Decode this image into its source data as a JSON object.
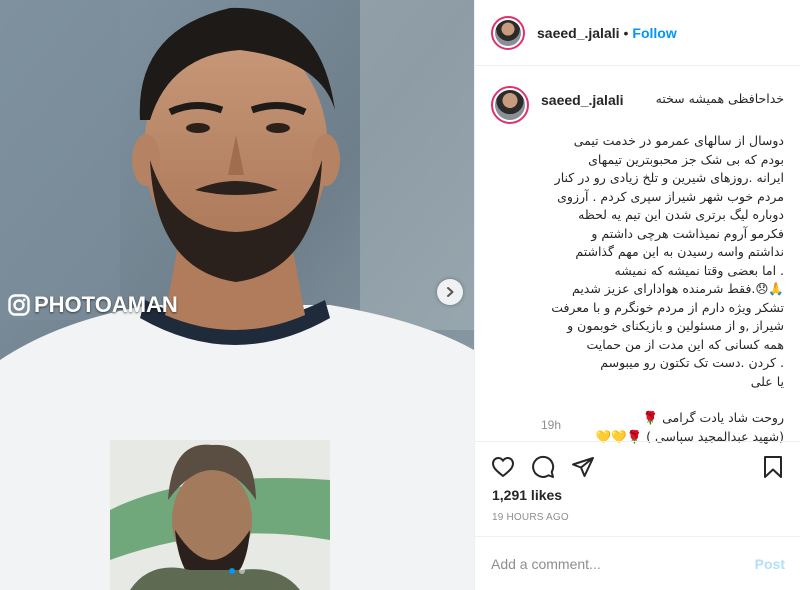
{
  "photo": {
    "watermark_text": "PHOTOAMAN",
    "slides_total": 2,
    "active_slide": 1
  },
  "header": {
    "username": "saeed_.jalali",
    "separator": "•",
    "follow_label": "Follow"
  },
  "caption": {
    "username": "saeed_.jalali",
    "first_line": "خداحافظی همیشه سخته",
    "lines": [
      "دوسال از سالهای عمرمو در خدمت تیمی",
      "بودم که بی شک جز محبوبترین تیمهای",
      "ایرانه .روزهای شیرین و تلخ زیادی رو در کنار",
      "مردم خوب شهر شیراز سپری کردم . آرزوی",
      "دوباره لیگ برتری شدن این تیم یه لحظه",
      "فکرمو آروم نمیذاشت هرچی داشتم و",
      "نداشتم واسه رسیدن به این مهم گذاشتم",
      ". اما بعضی وقتا نمیشه که نمیشه",
      "🙏😞.فقط شرمنده هوادارای عزیز شدیم",
      "تشکر ویژه دارم از مردم خونگرم و با معرفت",
      "شیراز ,و از مسئولین و بازیکنای خوبمون و",
      "همه کسانی که این مدت از من حمایت",
      ". کردن .دست تک تکتون رو میبوسم",
      "یا علی"
    ],
    "tribute_lines": [
      "روحت شاد یادت گرامی 🌹",
      "(شهید عبدالمجید سپاسی ) 🌹💛💛"
    ],
    "time_ago": "19h"
  },
  "actions": {
    "like_icon": "heart-icon",
    "comment_icon": "comment-icon",
    "share_icon": "share-icon",
    "save_icon": "bookmark-icon"
  },
  "likes": "1,291 likes",
  "post_date": "19 HOURS AGO",
  "comment_box": {
    "placeholder": "Add a comment...",
    "post_label": "Post"
  },
  "colors": {
    "accent": "#0095f6",
    "post_disabled": "#b2dffc",
    "story_ring": "#e1306c"
  }
}
